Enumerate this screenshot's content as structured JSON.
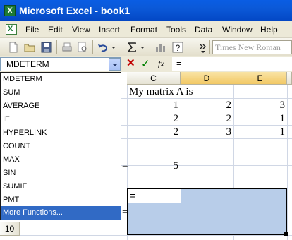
{
  "window": {
    "title": "Microsoft Excel - book1",
    "app_icon": "X"
  },
  "menu": {
    "items": [
      "File",
      "Edit",
      "View",
      "Insert",
      "Format",
      "Tools",
      "Data",
      "Window",
      "Help"
    ]
  },
  "toolbar": {
    "font_name": "Times New Roman"
  },
  "formula_bar": {
    "name_box": "MDETERM",
    "cancel_glyph": "✕",
    "enter_glyph": "✓",
    "fx_label": "fx",
    "formula": "="
  },
  "function_dropdown": {
    "items": [
      "MDETERM",
      "SUM",
      "AVERAGE",
      "IF",
      "HYPERLINK",
      "COUNT",
      "MAX",
      "SIN",
      "SUMIF",
      "PMT",
      "More Functions..."
    ],
    "highlighted_index": 10
  },
  "sheet": {
    "columns": [
      "C",
      "D",
      "E"
    ],
    "visible_rows": [
      "10"
    ],
    "label": "My matrix A is",
    "matrix": [
      [
        "1",
        "2",
        "3"
      ],
      [
        "2",
        "2",
        "1"
      ],
      [
        "2",
        "3",
        "1"
      ]
    ],
    "partial_marker_1": "=",
    "result": "5",
    "partial_marker_2": "=",
    "active_cell_text": "="
  },
  "colors": {
    "title_bar": "#0a5de4",
    "selection": "#b8cde9",
    "highlight": "#316ac5"
  }
}
